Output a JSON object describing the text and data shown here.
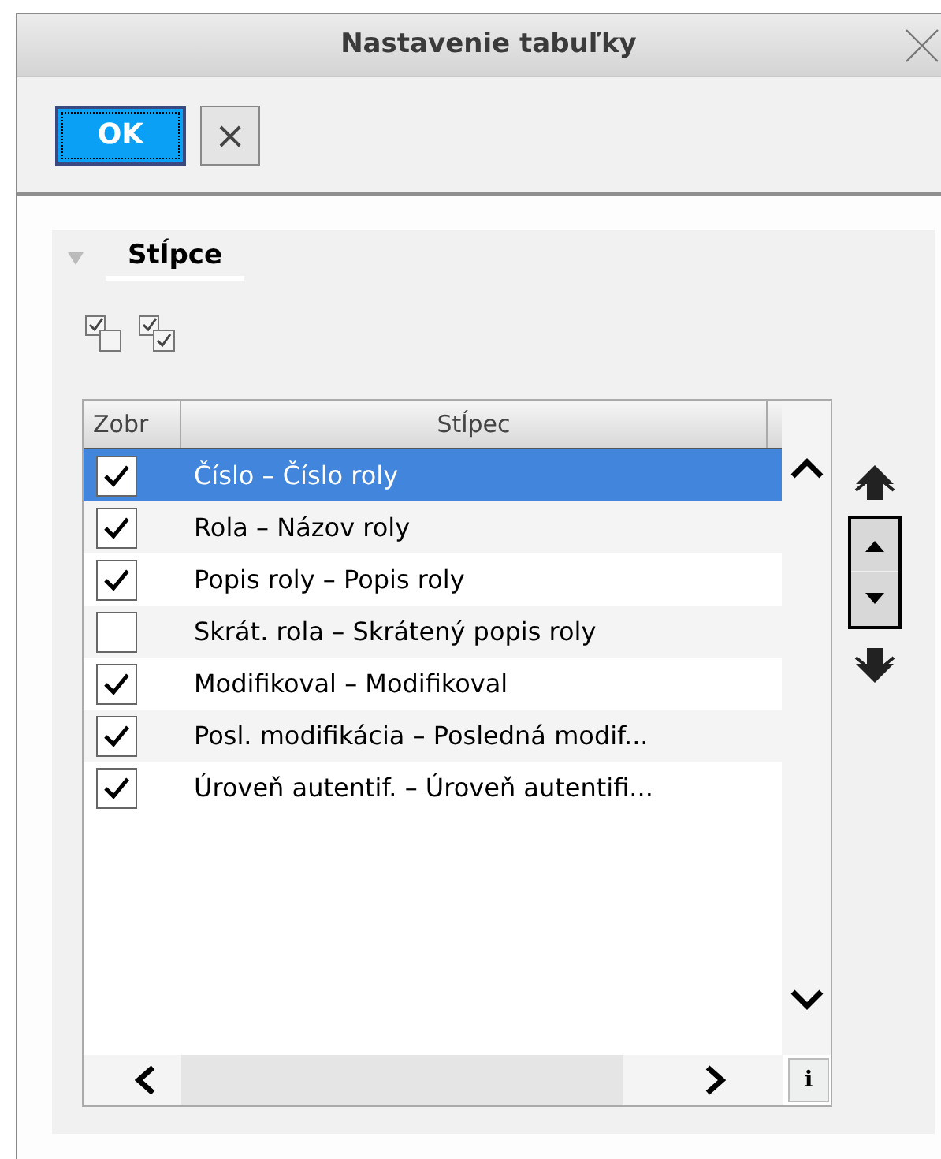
{
  "window": {
    "title": "Nastavenie tabuľky"
  },
  "toolbar": {
    "ok": "OK",
    "cancel": "×"
  },
  "section": {
    "title": "Stĺpce",
    "expanded": true
  },
  "table": {
    "columns": [
      "Zobr",
      "Stĺpec"
    ],
    "rows": [
      {
        "label": "Číslo – Číslo roly",
        "checked": true,
        "selected": true
      },
      {
        "label": "Rola – Názov roly",
        "checked": true,
        "selected": false
      },
      {
        "label": "Popis roly – Popis roly",
        "checked": true,
        "selected": false
      },
      {
        "label": "Skrát. rola – Skrátený popis roly",
        "checked": false,
        "selected": false
      },
      {
        "label": "Modifikoval – Modifikoval",
        "checked": true,
        "selected": false
      },
      {
        "label": "Posl. modifikácia – Posledná modif...",
        "checked": true,
        "selected": false
      },
      {
        "label": "Úroveň autentif. – Úroveň autentifi...",
        "checked": true,
        "selected": false
      }
    ],
    "info_button": "i"
  }
}
